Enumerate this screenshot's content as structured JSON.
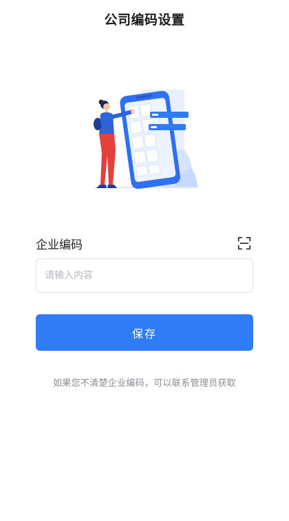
{
  "header": {
    "title": "公司编码设置"
  },
  "form": {
    "label": "企业编码",
    "input_value": "",
    "input_placeholder": "请输入内容",
    "scan_icon": "scan-icon"
  },
  "actions": {
    "save_label": "保存"
  },
  "hint": {
    "text": "如果您不清楚企业编码，可以联系管理员获取"
  },
  "colors": {
    "accent": "#2f7cf6",
    "text_primary": "#222222",
    "text_hint": "#8a8d93",
    "border": "#dcdfe6"
  }
}
